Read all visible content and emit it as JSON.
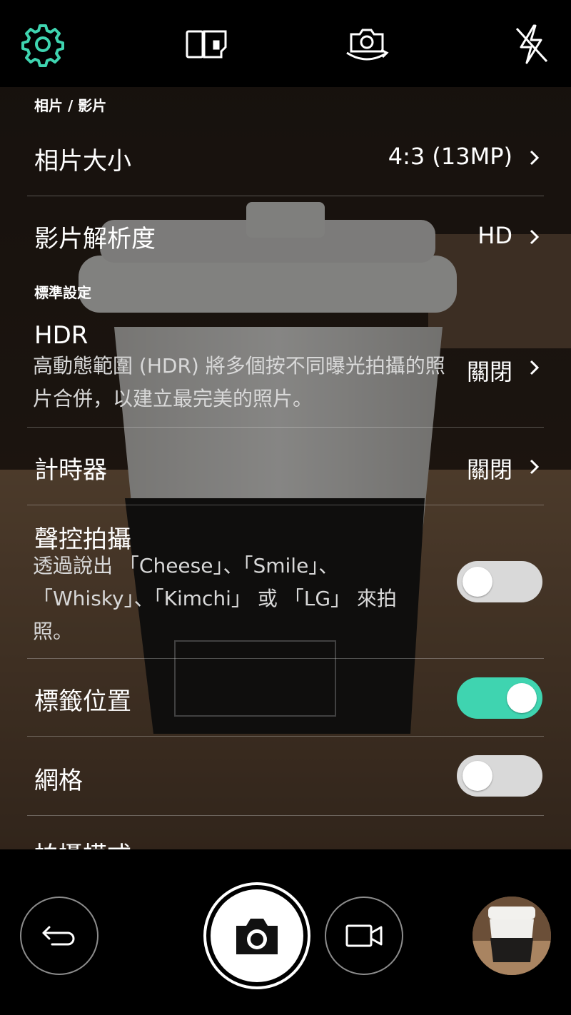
{
  "top_bar": {
    "settings_icon": "gear-icon",
    "storage_icon": "sd-card-icon",
    "switch_camera_icon": "switch-camera-icon",
    "flash_icon": "flash-off-icon",
    "accent_color": "#3fd4b0"
  },
  "settings": {
    "section_photo_video": "相片 / 影片",
    "photo_size": {
      "label": "相片大小",
      "value": "4:3 (13MP)"
    },
    "video_resolution": {
      "label": "影片解析度",
      "value": "HD"
    },
    "section_standard": "標準設定",
    "hdr": {
      "label": "HDR",
      "description": "高動態範圍 (HDR) 將多個按不同曝光拍攝的照片合併，以建立最完美的照片。",
      "value": "關閉"
    },
    "timer": {
      "label": "計時器",
      "value": "關閉"
    },
    "voice_shutter": {
      "label": "聲控拍攝",
      "description": "透過說出 「Cheese」、「Smile」、「Whisky」、「Kimchi」 或 「LG」 來拍照。",
      "enabled": false
    },
    "tag_location": {
      "label": "標籤位置",
      "enabled": true
    },
    "grid": {
      "label": "網格",
      "enabled": false
    },
    "shot_mode_partial": {
      "label": "拍攝模式"
    }
  },
  "bottom_bar": {
    "back_icon": "back-arrow-icon",
    "shutter_icon": "camera-icon",
    "video_icon": "video-camera-icon",
    "gallery_icon": "gallery-thumbnail"
  }
}
